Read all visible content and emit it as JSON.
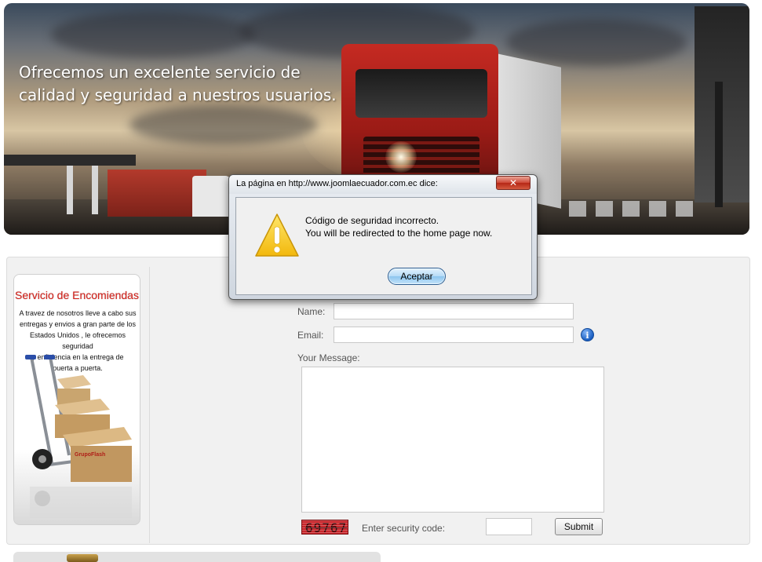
{
  "hero": {
    "tagline_line1": "Ofrecemos un excelente servicio de",
    "tagline_line2": "calidad y seguridad a nuestros usuarios."
  },
  "promo": {
    "title": "Servicio de Encomiendas",
    "text_line1": "A travez de nosotros lleve a cabo sus",
    "text_line2": "entregas y envios  a  gran parte de los",
    "text_line3": "Estados Unidos , le ofrecemos seguridad",
    "text_line4": "y enficiencia en la entrega de",
    "text_line5": "puerta a puerta.",
    "box_brand": "GrupoFlash"
  },
  "form": {
    "name_label": "Name:",
    "name_value": "",
    "email_label": "Email:",
    "email_value": "",
    "info_icon": "i",
    "message_label": "Your Message:",
    "message_value": "",
    "captcha_text": "69767",
    "security_label": "Enter security code:",
    "security_value": "",
    "submit_label": "Submit"
  },
  "dialog": {
    "title": "La página en http://www.joomlaecuador.com.ec dice:",
    "close_glyph": "✕",
    "message_line1": "Código de seguridad incorrecto.",
    "message_line2": "You will be redirected to the home page now.",
    "ok_label": "Aceptar"
  },
  "colors": {
    "promo_title": "#d9231c",
    "close_button": "#c43b2a",
    "ok_button": "#9fd0f2",
    "captcha_bg": "#c8262b",
    "info_icon": "#1b5fc2"
  },
  "icons": {
    "warning": "warning-icon",
    "info": "info-icon",
    "close": "close-icon"
  }
}
